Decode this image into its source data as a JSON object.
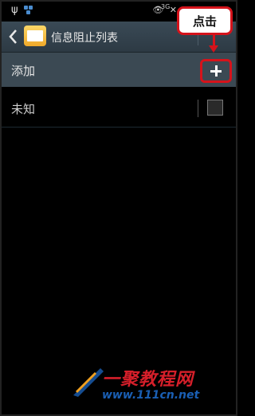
{
  "status_bar": {
    "usb_icon": "usb-icon",
    "network": "3G"
  },
  "action_bar": {
    "title": "信息阻止列表",
    "back_icon": "chevron-left-icon",
    "app_icon": "messages-envelope-icon"
  },
  "list": {
    "add_label": "添加",
    "add_icon": "plus-icon",
    "unknown_label": "未知",
    "unknown_checked": false
  },
  "annotation": {
    "callout_text": "点击",
    "color": "#d5131b"
  },
  "watermark": {
    "name": "一聚教程网",
    "url": "www.111cn.net"
  }
}
